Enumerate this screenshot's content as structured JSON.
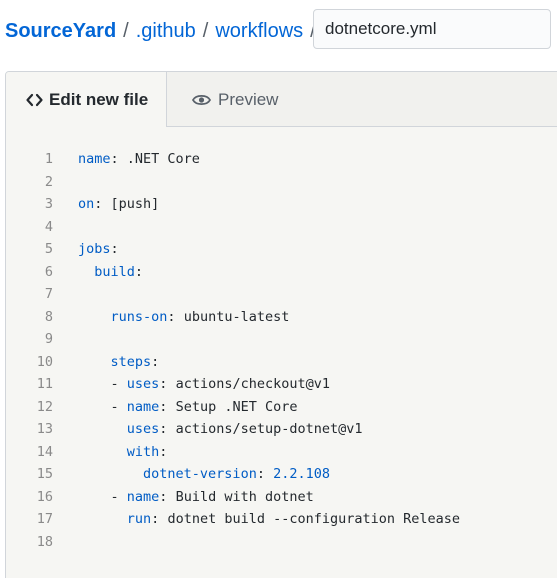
{
  "breadcrumb": {
    "owner": "SourceYard",
    "separator": "/",
    "folders": [
      ".github",
      "workflows"
    ]
  },
  "filename": {
    "value": "dotnetcore.yml"
  },
  "tabs": {
    "edit": {
      "label": "Edit new file",
      "icon": "code-icon"
    },
    "preview": {
      "label": "Preview",
      "icon": "eye-icon"
    }
  },
  "colors": {
    "link": "#0366d6",
    "key": "#005cc5",
    "text": "#24292e",
    "line_number": "#8a8a8a",
    "editor_bg": "#f6f6f3"
  },
  "editor": {
    "lines": [
      {
        "num": "1",
        "indent": "",
        "dash": "",
        "key": "name",
        "sep": ": ",
        "value": ".NET Core",
        "value_type": "text"
      },
      {
        "num": "2",
        "indent": "",
        "dash": "",
        "key": "",
        "sep": "",
        "value": "",
        "value_type": "text"
      },
      {
        "num": "3",
        "indent": "",
        "dash": "",
        "key": "on",
        "sep": ": ",
        "value": "[push]",
        "value_type": "text"
      },
      {
        "num": "4",
        "indent": "",
        "dash": "",
        "key": "",
        "sep": "",
        "value": "",
        "value_type": "text"
      },
      {
        "num": "5",
        "indent": "",
        "dash": "",
        "key": "jobs",
        "sep": ":",
        "value": "",
        "value_type": "text"
      },
      {
        "num": "6",
        "indent": "  ",
        "dash": "",
        "key": "build",
        "sep": ":",
        "value": "",
        "value_type": "text"
      },
      {
        "num": "7",
        "indent": "",
        "dash": "",
        "key": "",
        "sep": "",
        "value": "",
        "value_type": "text"
      },
      {
        "num": "8",
        "indent": "    ",
        "dash": "",
        "key": "runs-on",
        "sep": ": ",
        "value": "ubuntu-latest",
        "value_type": "text"
      },
      {
        "num": "9",
        "indent": "",
        "dash": "",
        "key": "",
        "sep": "",
        "value": "",
        "value_type": "text"
      },
      {
        "num": "10",
        "indent": "    ",
        "dash": "",
        "key": "steps",
        "sep": ":",
        "value": "",
        "value_type": "text"
      },
      {
        "num": "11",
        "indent": "    ",
        "dash": "- ",
        "key": "uses",
        "sep": ": ",
        "value": "actions/checkout@v1",
        "value_type": "text"
      },
      {
        "num": "12",
        "indent": "    ",
        "dash": "- ",
        "key": "name",
        "sep": ": ",
        "value": "Setup .NET Core",
        "value_type": "text"
      },
      {
        "num": "13",
        "indent": "      ",
        "dash": "",
        "key": "uses",
        "sep": ": ",
        "value": "actions/setup-dotnet@v1",
        "value_type": "text"
      },
      {
        "num": "14",
        "indent": "      ",
        "dash": "",
        "key": "with",
        "sep": ":",
        "value": "",
        "value_type": "text"
      },
      {
        "num": "15",
        "indent": "        ",
        "dash": "",
        "key": "dotnet-version",
        "sep": ": ",
        "value": "2.2.108",
        "value_type": "number"
      },
      {
        "num": "16",
        "indent": "    ",
        "dash": "- ",
        "key": "name",
        "sep": ": ",
        "value": "Build with dotnet",
        "value_type": "text"
      },
      {
        "num": "17",
        "indent": "      ",
        "dash": "",
        "key": "run",
        "sep": ": ",
        "value": "dotnet build --configuration Release",
        "value_type": "text"
      },
      {
        "num": "18",
        "indent": "",
        "dash": "",
        "key": "",
        "sep": "",
        "value": "",
        "value_type": "text"
      }
    ]
  }
}
